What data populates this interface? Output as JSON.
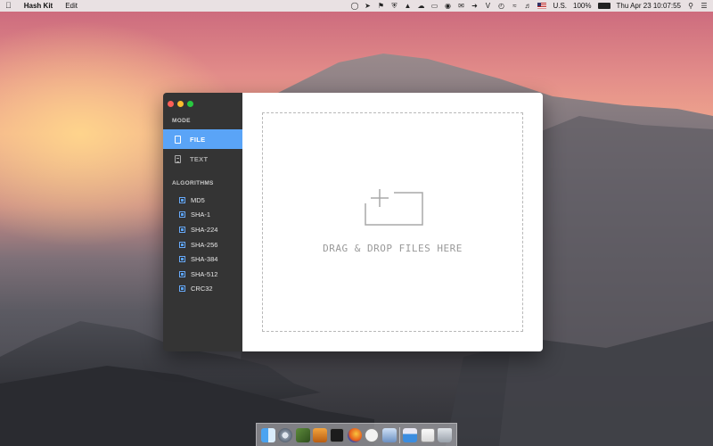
{
  "menubar": {
    "app_name": "Hash Kit",
    "menus": [
      "Edit"
    ],
    "region": "U.S.",
    "battery": "100%",
    "clock": "Thu Apr 23  10:07:55"
  },
  "sidebar": {
    "mode_label": "MODE",
    "modes": [
      {
        "label": "FILE",
        "active": true
      },
      {
        "label": "TEXT",
        "active": false
      }
    ],
    "algorithms_label": "ALGORITHMS",
    "algorithms": [
      {
        "label": "MD5",
        "checked": true
      },
      {
        "label": "SHA-1",
        "checked": true
      },
      {
        "label": "SHA-224",
        "checked": true
      },
      {
        "label": "SHA-256",
        "checked": true
      },
      {
        "label": "SHA-384",
        "checked": true
      },
      {
        "label": "SHA-512",
        "checked": true
      },
      {
        "label": "CRC32",
        "checked": true
      }
    ]
  },
  "dropzone": {
    "text": "DRAG & DROP FILES HERE"
  },
  "colors": {
    "sidebar_bg": "#343434",
    "accent": "#5aa4f7",
    "traffic_red": "#fc5f57",
    "traffic_yellow": "#fdbc2e",
    "traffic_green": "#28c840"
  },
  "dock": {
    "apps": [
      "finder-icon",
      "safari-icon",
      "xcode-icon",
      "sublime-icon",
      "terminal-icon",
      "firefox-icon",
      "hash-kit-icon",
      "preview-icon",
      "calendar-icon",
      "mail-icon",
      "trash-icon"
    ]
  }
}
